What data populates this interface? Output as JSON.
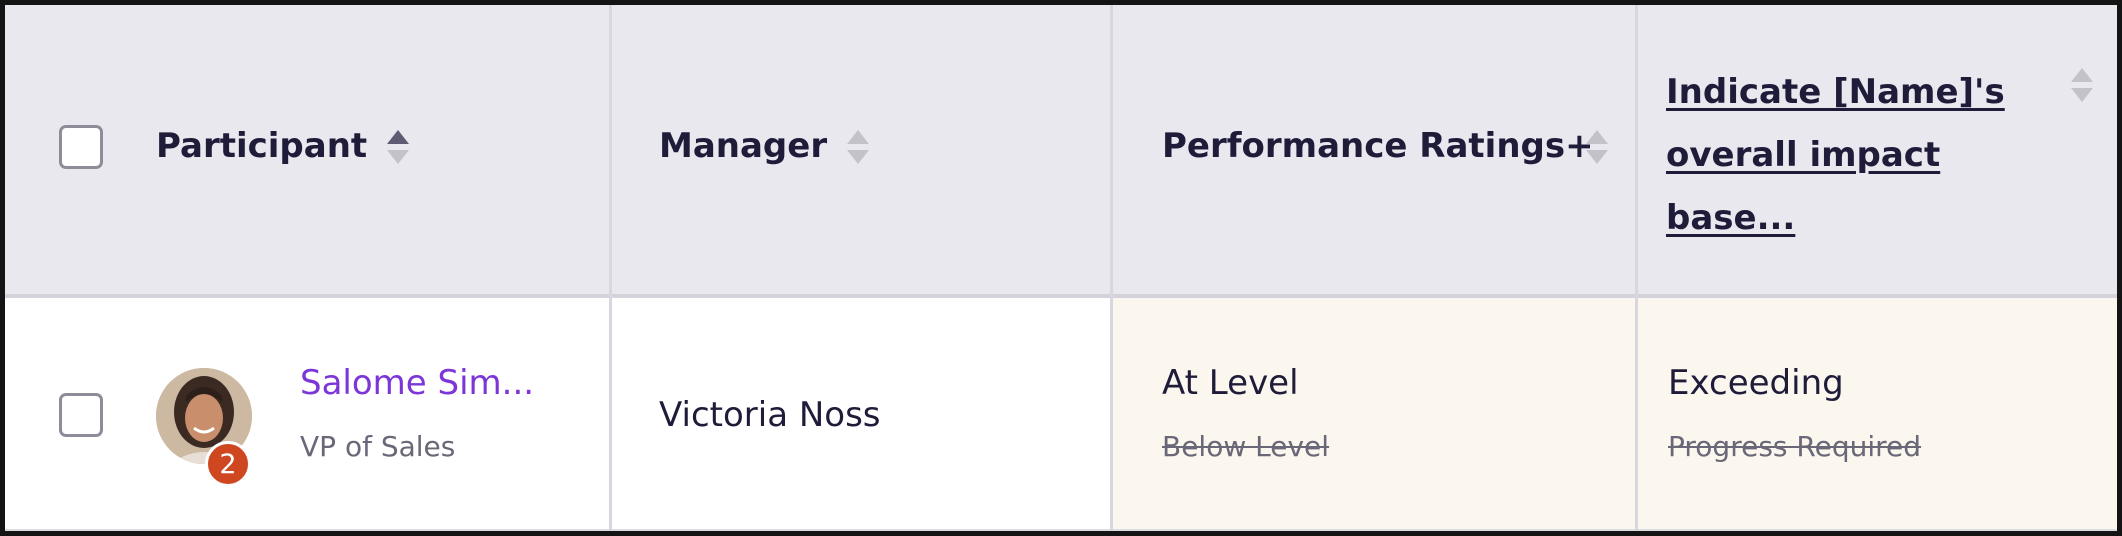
{
  "table": {
    "columns": [
      {
        "label": "Participant",
        "sort": "ascending"
      },
      {
        "label": "Manager",
        "sort": "none"
      },
      {
        "label": "Performance Ratings+",
        "sort": "none"
      },
      {
        "label": "Indicate [Name]'s overall impact base...",
        "sort": "none"
      }
    ],
    "rows": [
      {
        "participant": {
          "name": "Salome Sim...",
          "title": "VP of Sales",
          "badge_count": "2"
        },
        "manager": "Victoria Noss",
        "performance_rating": {
          "current": "At Level",
          "previous": "Below Level"
        },
        "overall_impact": {
          "current": "Exceeding",
          "previous": "Progress Required"
        }
      }
    ]
  },
  "colors": {
    "header_bg": "#e9e8ee",
    "link_purple": "#7b35d8",
    "badge_red": "#cf4721",
    "highlight_cell": "#fbf7ee"
  }
}
